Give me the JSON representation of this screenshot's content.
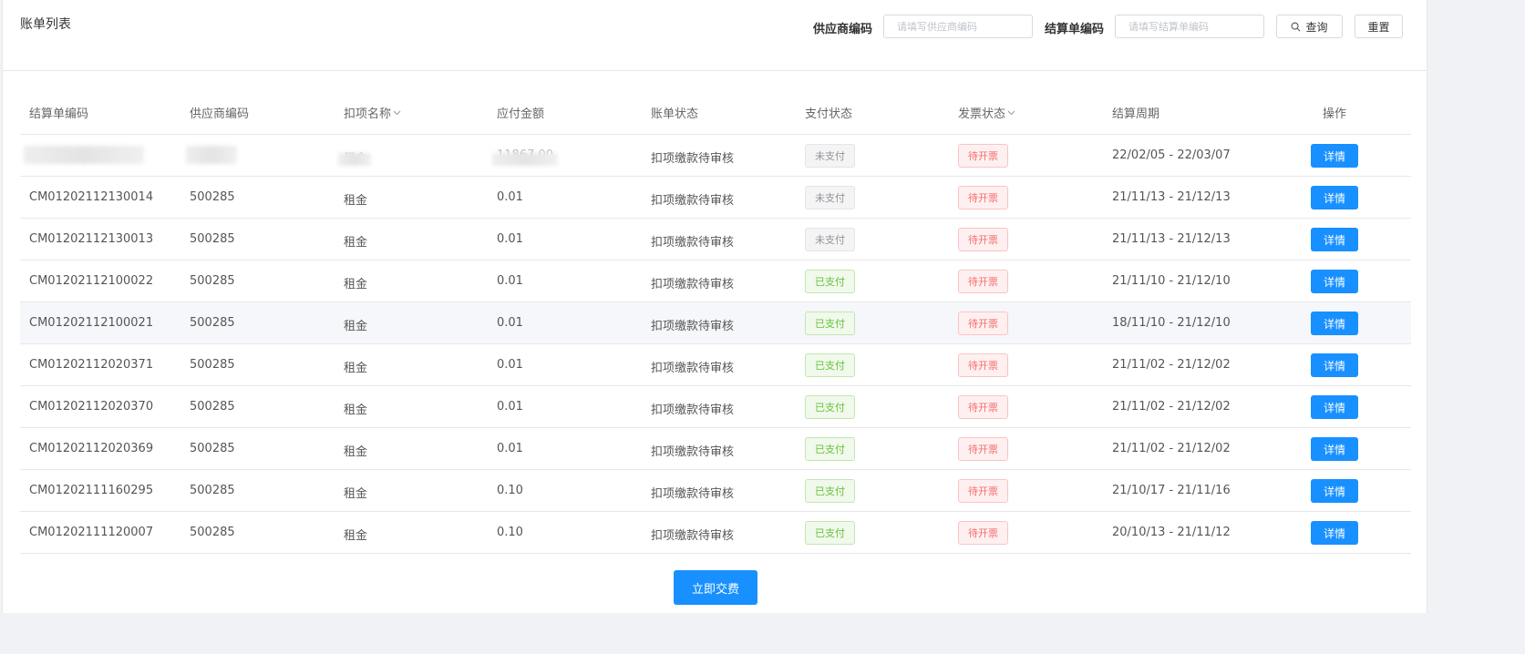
{
  "header": {
    "title": "账单列表",
    "filters": {
      "supplier_label": "供应商编码",
      "supplier_placeholder": "请填写供应商编码",
      "settlement_label": "结算单编码",
      "settlement_placeholder": "请填写结算单编码"
    },
    "search_label": "查询",
    "reset_label": "重置"
  },
  "table": {
    "columns": [
      "结算单编码",
      "供应商编码",
      "扣项名称",
      "应付金额",
      "账单状态",
      "支付状态",
      "发票状态",
      "结算周期",
      "操作"
    ],
    "rows": [
      {
        "code": "",
        "supplier": "",
        "item": "租金",
        "amount": "11867.00",
        "bill_status": "扣项缴款待审核",
        "pay_status": "未支付",
        "pay_state": "unpaid",
        "invoice_status": "待开票",
        "period": "22/02/05 - 22/03/07",
        "action": "详情",
        "redacted": true
      },
      {
        "code": "CM01202112130014",
        "supplier": "500285",
        "item": "租金",
        "amount": "0.01",
        "bill_status": "扣项缴款待审核",
        "pay_status": "未支付",
        "pay_state": "unpaid",
        "invoice_status": "待开票",
        "period": "21/11/13 - 21/12/13",
        "action": "详情"
      },
      {
        "code": "CM01202112130013",
        "supplier": "500285",
        "item": "租金",
        "amount": "0.01",
        "bill_status": "扣项缴款待审核",
        "pay_status": "未支付",
        "pay_state": "unpaid",
        "invoice_status": "待开票",
        "period": "21/11/13 - 21/12/13",
        "action": "详情"
      },
      {
        "code": "CM01202112100022",
        "supplier": "500285",
        "item": "租金",
        "amount": "0.01",
        "bill_status": "扣项缴款待审核",
        "pay_status": "已支付",
        "pay_state": "paid",
        "invoice_status": "待开票",
        "period": "21/11/10 - 21/12/10",
        "action": "详情"
      },
      {
        "code": "CM01202112100021",
        "supplier": "500285",
        "item": "租金",
        "amount": "0.01",
        "bill_status": "扣项缴款待审核",
        "pay_status": "已支付",
        "pay_state": "paid",
        "invoice_status": "待开票",
        "period": "18/11/10 - 21/12/10",
        "action": "详情",
        "hover": true
      },
      {
        "code": "CM01202112020371",
        "supplier": "500285",
        "item": "租金",
        "amount": "0.01",
        "bill_status": "扣项缴款待审核",
        "pay_status": "已支付",
        "pay_state": "paid",
        "invoice_status": "待开票",
        "period": "21/11/02 - 21/12/02",
        "action": "详情"
      },
      {
        "code": "CM01202112020370",
        "supplier": "500285",
        "item": "租金",
        "amount": "0.01",
        "bill_status": "扣项缴款待审核",
        "pay_status": "已支付",
        "pay_state": "paid",
        "invoice_status": "待开票",
        "period": "21/11/02 - 21/12/02",
        "action": "详情"
      },
      {
        "code": "CM01202112020369",
        "supplier": "500285",
        "item": "租金",
        "amount": "0.01",
        "bill_status": "扣项缴款待审核",
        "pay_status": "已支付",
        "pay_state": "paid",
        "invoice_status": "待开票",
        "period": "21/11/02 - 21/12/02",
        "action": "详情"
      },
      {
        "code": "CM01202111160295",
        "supplier": "500285",
        "item": "租金",
        "amount": "0.10",
        "bill_status": "扣项缴款待审核",
        "pay_status": "已支付",
        "pay_state": "paid",
        "invoice_status": "待开票",
        "period": "21/10/17 - 21/11/16",
        "action": "详情"
      },
      {
        "code": "CM01202111120007",
        "supplier": "500285",
        "item": "租金",
        "amount": "0.10",
        "bill_status": "扣项缴款待审核",
        "pay_status": "已支付",
        "pay_state": "paid",
        "invoice_status": "待开票",
        "period": "20/10/13 - 21/11/12",
        "action": "详情"
      }
    ]
  },
  "footer": {
    "pay_now_label": "立即交费"
  },
  "icons": {
    "search": "search-icon",
    "sort": "chevron-down-icon"
  },
  "colors": {
    "primary": "#1890ff",
    "paid": "#67c23a",
    "unpaid": "#909399",
    "invoice_pending": "#f56c6c"
  }
}
